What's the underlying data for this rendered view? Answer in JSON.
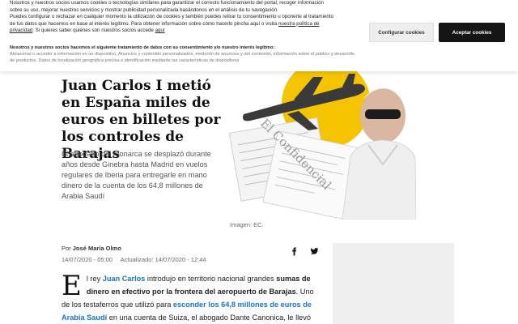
{
  "cookie_banner": {
    "main_lines": [
      "Nosotros y nuestros socios usamos cookies o tecnologías similares para garantizar el correcto funcionamiento del portal, recoger información",
      "sobre su uso, mejorar nuestros servicios y mostrar publicidad personalizada basándonos en el análisis de tu navegación.",
      "Puedes configurar o rechazar en cualquier momento la utilización de cookies y también puedes retirar tu consentimiento u oponerte al tratamiento",
      "de tus datos que hacemos en base al interés legítimo. Para obtener información sobre cómo hacerlo pincha aquí o visita"
    ],
    "privacy_link": "nuestra política de privacidad",
    "partners_sentence": "Si quieres saber quiénes son nuestros socios accede",
    "partners_link": "aquí",
    "legit_title": "Nosotros y nuestros socios hacemos el siguiente tratamiento de datos con su consentimiento y/o nuestro interés legítimo:",
    "legit_body": "Almacenar o acceder a información en un dispositivo, Anuncios y contenido personalizados, medición de anuncios y del contenido, información sobre el público y desarrollo de productos, Datos de localización geográfica precisa e identificación mediante las características de dispositivos",
    "configure_label": "Configurar cookies",
    "accept_label": "Aceptar cookies"
  },
  "article": {
    "headline": "Juan Carlos I metió en España miles de euros en billetes por los controles de Barajas",
    "standfirst": "El abogado del monarca se desplazó durante años desde Ginebra hasta Madrid en vuelos regulares de Iberia para entregarle en mano dinero de la cuenta de los 64,8 millones de Arabia Saudí",
    "image_caption": "Imagen: EC.",
    "byline_prefix": "Por",
    "author": "José María Olmo",
    "published": "14/07/2020 - 05:00",
    "updated": "Actualizado: 14/07/2020 - 12:44",
    "dropcap": "E",
    "body": {
      "p1": "l rey ",
      "link1": "Juan Carlos",
      "p2": " introdujo en territorio nacional grandes ",
      "bold1": "sumas de dinero en efectivo por la frontera del aeropuerto de Barajas",
      "p3": ". Uno de los testaferros que utilizó para ",
      "link2": "esconder los 64,8 millones de euros de Arabia Saudí",
      "p4": " en una cuenta de Suiza, el abogado Dante Canonica, le llevó presuntamente durante años fondos de ese depósito hasta el Palacio de la"
    }
  },
  "hero_image": {
    "watermark": "El Confidencial",
    "accent_color": "#f5c400"
  },
  "share": {
    "facebook_icon": "facebook-icon",
    "twitter_icon": "twitter-icon"
  }
}
